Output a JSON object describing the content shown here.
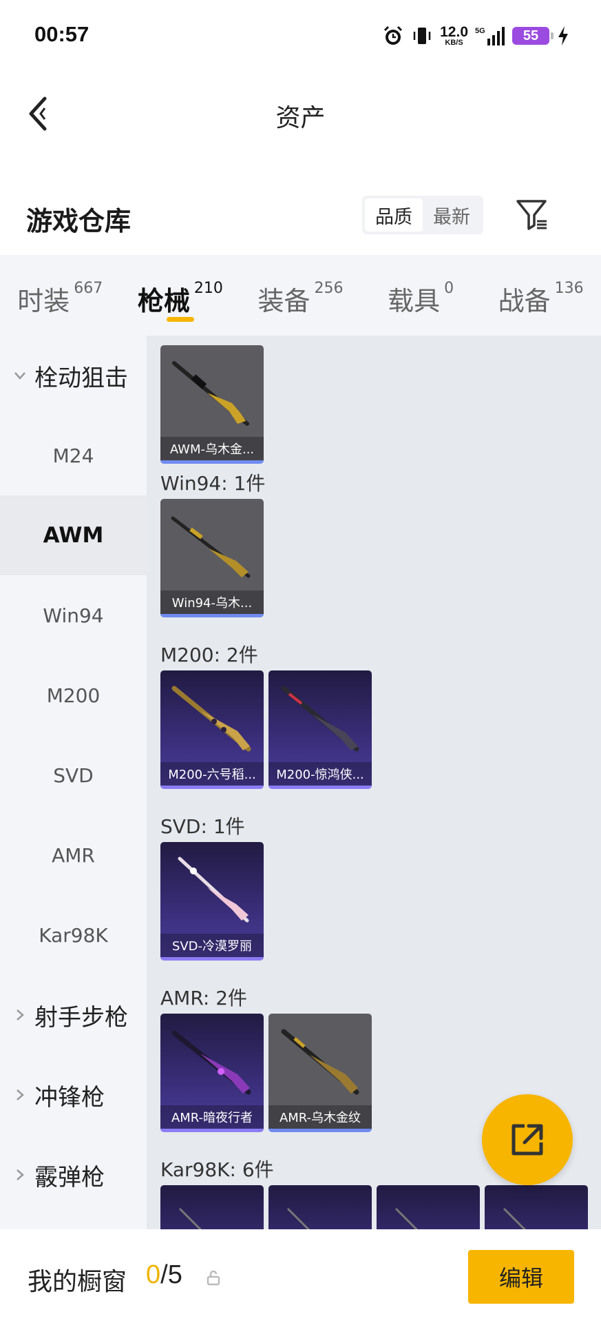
{
  "status_bar": {
    "time": "00:57",
    "net_speed": "12.0",
    "net_unit": "KB/S",
    "signal": "5G",
    "battery": "55",
    "icons": [
      "alarm-icon",
      "vibrate-icon",
      "signal-icon",
      "charging-icon"
    ]
  },
  "header": {
    "title": "资产",
    "back_icon": "chevron-left-icon"
  },
  "section": {
    "title": "游戏仓库",
    "sort_options": [
      "品质",
      "最新"
    ],
    "sort_active": "品质",
    "filter_icon": "filter-icon"
  },
  "tabs": [
    {
      "label": "时装",
      "count": "667"
    },
    {
      "label": "枪械",
      "count": "210",
      "active": true
    },
    {
      "label": "装备",
      "count": "256"
    },
    {
      "label": "载具",
      "count": "0"
    },
    {
      "label": "战备",
      "count": "136"
    }
  ],
  "sidenav": {
    "group_open": "栓动狙击",
    "items": [
      "M24",
      "AWM",
      "Win94",
      "M200",
      "SVD",
      "AMR",
      "Kar98K"
    ],
    "active_item": "AWM",
    "groups_closed": [
      "射手步枪",
      "冲锋枪",
      "霰弹枪"
    ]
  },
  "content": {
    "groups": [
      {
        "label": "",
        "items": [
          "AWM-乌木金..."
        ]
      },
      {
        "label": "Win94: 1件",
        "items": [
          "Win94-乌木..."
        ]
      },
      {
        "label": "M200: 2件",
        "items": [
          "M200-六号稻...",
          "M200-惊鸿侠..."
        ]
      },
      {
        "label": "SVD: 1件",
        "items": [
          "SVD-冷漠罗丽"
        ]
      },
      {
        "label": "AMR: 2件",
        "items": [
          "AMR-暗夜行者",
          "AMR-乌木金纹"
        ]
      },
      {
        "label": "Kar98K: 6件",
        "items": []
      }
    ]
  },
  "fab": {
    "icon": "share-icon"
  },
  "bottom_bar": {
    "label": "我的橱窗",
    "current": "0",
    "total": "/5",
    "lock_icon": "lock-icon",
    "edit_label": "编辑"
  },
  "colors": {
    "accent": "#f7b500",
    "card_grey": "#5c5b60",
    "card_purple": "#3a2e7a"
  }
}
